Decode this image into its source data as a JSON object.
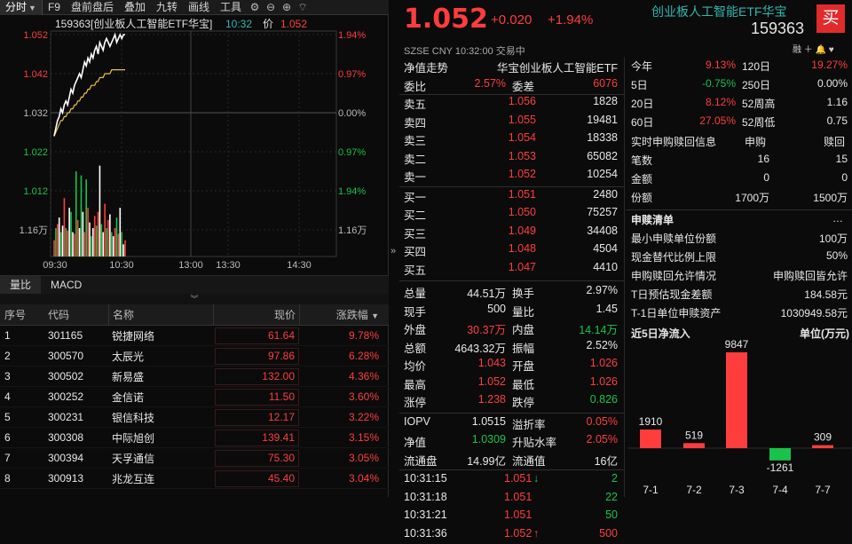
{
  "toolbar": {
    "tabs": [
      "分时",
      "F9",
      "盘前盘后",
      "叠加",
      "九转",
      "画线",
      "工具"
    ]
  },
  "chart": {
    "header": {
      "code_name": "159363[创业板人工智能ETF华宝]",
      "time": "10:32",
      "price_label": "价",
      "price": "1.052"
    },
    "y_left": [
      "1.052",
      "1.042",
      "1.032",
      "1.022",
      "1.012",
      "1.16万"
    ],
    "y_right": [
      "1.94%",
      "0.97%",
      "0.00%",
      "0.97%",
      "1.94%",
      "1.16万"
    ],
    "x_labels": [
      "09:30",
      "10:30",
      "13:00",
      "13:30",
      "14:30"
    ]
  },
  "chart_data": {
    "type": "line",
    "title": "159363[创业板人工智能ETF华宝]",
    "xlabel": "",
    "ylabel": "",
    "ylim": [
      1.012,
      1.052
    ],
    "prev_close": 1.032,
    "x_ticks": [
      "09:30",
      "10:30",
      "13:00",
      "13:30",
      "14:30"
    ],
    "series": [
      {
        "name": "价",
        "values": [
          1.026,
          1.028,
          1.03,
          1.031,
          1.033,
          1.032,
          1.034,
          1.035,
          1.034,
          1.036,
          1.038,
          1.037,
          1.039,
          1.04,
          1.041,
          1.042,
          1.041,
          1.043,
          1.045,
          1.044,
          1.046,
          1.045,
          1.047,
          1.046,
          1.048,
          1.049,
          1.047,
          1.05,
          1.049,
          1.048,
          1.05,
          1.051,
          1.05,
          1.049,
          1.05,
          1.051,
          1.052,
          1.05,
          1.051,
          1.052,
          1.051,
          1.052,
          1.052
        ]
      },
      {
        "name": "均价",
        "values": [
          1.026,
          1.027,
          1.028,
          1.029,
          1.03,
          1.03,
          1.031,
          1.031,
          1.032,
          1.032,
          1.033,
          1.033,
          1.034,
          1.034,
          1.035,
          1.035,
          1.036,
          1.036,
          1.037,
          1.037,
          1.038,
          1.038,
          1.039,
          1.039,
          1.039,
          1.04,
          1.04,
          1.041,
          1.041,
          1.041,
          1.042,
          1.042,
          1.042,
          1.042,
          1.043,
          1.043,
          1.043,
          1.043,
          1.043,
          1.043,
          1.043,
          1.043,
          1.043
        ]
      }
    ],
    "volume_max": 11600,
    "volume": [
      2000,
      3500,
      4000,
      4800,
      3000,
      3800,
      7200,
      3500,
      3200,
      6000,
      5500,
      3000,
      2800,
      10500,
      4500,
      3500,
      10000,
      5500,
      3000,
      9500,
      6000,
      4200,
      2500,
      3500,
      5000,
      3800,
      5500,
      11200,
      4000,
      3000,
      6500,
      3500,
      4500,
      5200,
      3000,
      2500,
      3500,
      4800,
      2800,
      6000,
      3000,
      1500,
      2000
    ]
  },
  "subtabs": [
    "量比",
    "MACD"
  ],
  "table": {
    "headers": [
      "序号",
      "代码",
      "名称",
      "现价",
      "涨跌幅"
    ],
    "rows": [
      {
        "n": "1",
        "code": "301165",
        "name": "锐捷网络",
        "price": "61.64",
        "pct": "9.78%"
      },
      {
        "n": "2",
        "code": "300570",
        "name": "太辰光",
        "price": "97.86",
        "pct": "6.28%"
      },
      {
        "n": "3",
        "code": "300502",
        "name": "新易盛",
        "price": "132.00",
        "pct": "4.36%"
      },
      {
        "n": "4",
        "code": "300252",
        "name": "金信诺",
        "price": "11.50",
        "pct": "3.60%"
      },
      {
        "n": "5",
        "code": "300231",
        "name": "银信科技",
        "price": "12.17",
        "pct": "3.22%"
      },
      {
        "n": "6",
        "code": "300308",
        "name": "中际旭创",
        "price": "139.41",
        "pct": "3.15%"
      },
      {
        "n": "7",
        "code": "300394",
        "name": "天孚通信",
        "price": "75.30",
        "pct": "3.05%"
      },
      {
        "n": "8",
        "code": "300913",
        "name": "兆龙互连",
        "price": "45.40",
        "pct": "3.04%"
      }
    ]
  },
  "quote": {
    "price": "1.052",
    "change": "+0.020",
    "pct": "+1.94%",
    "name": "创业板人工智能ETF华宝",
    "code": "159363",
    "buy": "买",
    "meta": "SZSE   CNY   10:32:00  交易中",
    "meta_icons": "融 ＋ 🔔 ♥"
  },
  "book": {
    "title_l": "净值走势",
    "title_r": "华宝创业板人工智能ETF",
    "wb_l": "委比",
    "wb_v": "2.57%",
    "wc_l": "委差",
    "wc_v": "6076",
    "asks": [
      {
        "l": "卖五",
        "p": "1.056",
        "v": "1828"
      },
      {
        "l": "卖四",
        "p": "1.055",
        "v": "19481"
      },
      {
        "l": "卖三",
        "p": "1.054",
        "v": "18338"
      },
      {
        "l": "卖二",
        "p": "1.053",
        "v": "65082"
      },
      {
        "l": "卖一",
        "p": "1.052",
        "v": "10254"
      }
    ],
    "bids": [
      {
        "l": "买一",
        "p": "1.051",
        "v": "2480"
      },
      {
        "l": "买二",
        "p": "1.050",
        "v": "75257"
      },
      {
        "l": "买三",
        "p": "1.049",
        "v": "34408"
      },
      {
        "l": "买四",
        "p": "1.048",
        "v": "4504"
      },
      {
        "l": "买五",
        "p": "1.047",
        "v": "4410"
      }
    ],
    "stats": [
      {
        "a": "总量",
        "av": "44.51万",
        "b": "换手",
        "bv": "2.97%"
      },
      {
        "a": "现手",
        "av": "500",
        "b": "量比",
        "bv": "1.45"
      },
      {
        "a": "外盘",
        "av": "30.37万",
        "b": "内盘",
        "bv": "14.14万"
      },
      {
        "a": "总额",
        "av": "4643.32万",
        "b": "振幅",
        "bv": "2.52%"
      },
      {
        "a": "均价",
        "av": "1.043",
        "b": "开盘",
        "bv": "1.026"
      },
      {
        "a": "最高",
        "av": "1.052",
        "b": "最低",
        "bv": "1.026"
      },
      {
        "a": "涨停",
        "av": "1.238",
        "b": "跌停",
        "bv": "0.826"
      }
    ],
    "stats2": [
      {
        "a": "IOPV",
        "av": "1.0515",
        "b": "溢折率",
        "bv": "0.05%"
      },
      {
        "a": "净值",
        "av": "1.0309",
        "b": "升贴水率",
        "bv": "2.05%"
      },
      {
        "a": "流通盘",
        "av": "14.99亿",
        "b": "流通值",
        "bv": "16亿"
      }
    ],
    "ticks": [
      {
        "t": "10:31:15",
        "p": "1.051",
        "arr": "↓",
        "v": "2"
      },
      {
        "t": "10:31:18",
        "p": "1.051",
        "arr": "",
        "v": "22"
      },
      {
        "t": "10:31:21",
        "p": "1.051",
        "arr": "",
        "v": "50"
      },
      {
        "t": "10:31:36",
        "p": "1.052",
        "arr": "↑",
        "v": "500"
      }
    ]
  },
  "perf": [
    {
      "a": "今年",
      "av": "9.13%",
      "b": "120日",
      "bv": "19.27%"
    },
    {
      "a": "5日",
      "av": "-0.75%",
      "b": "250日",
      "bv": "0.00%"
    },
    {
      "a": "20日",
      "av": "8.12%",
      "b": "52周高",
      "bv": "1.16"
    },
    {
      "a": "60日",
      "av": "27.05%",
      "b": "52周低",
      "bv": "0.75"
    }
  ],
  "redeem": {
    "title": "实时申购赎回信息",
    "c1": "申购",
    "c2": "赎回",
    "rows": [
      {
        "l": "笔数",
        "a": "16",
        "b": "15"
      },
      {
        "l": "金额",
        "a": "0",
        "b": "0"
      },
      {
        "l": "份额",
        "a": "1700万",
        "b": "1500万"
      }
    ]
  },
  "list": {
    "title": "申赎清单",
    "more": "…",
    "rows": [
      {
        "l": "最小申赎单位份额",
        "v": "100万"
      },
      {
        "l": "现金替代比例上限",
        "v": "50%"
      },
      {
        "l": "申购赎回允许情况",
        "v": "申购赎回皆允许"
      },
      {
        "l": "T日预估现金差额",
        "v": "184.58元"
      },
      {
        "l": "T-1日单位申赎资产",
        "v": "1030949.58元"
      }
    ]
  },
  "flow": {
    "title": "近5日净流入",
    "unit": "单位(万元)"
  },
  "flow_chart": {
    "type": "bar",
    "categories": [
      "7-1",
      "7-2",
      "7-3",
      "7-4",
      "7-7"
    ],
    "values": [
      1910,
      519,
      9847,
      -1261,
      309
    ],
    "labels": [
      "1910",
      "519",
      "9847",
      "-1261",
      "309"
    ]
  },
  "colors": {
    "up": "#ff3d3d",
    "down": "#19c34a",
    "avg": "#e8c14a",
    "accent": "#2fb7b0"
  }
}
